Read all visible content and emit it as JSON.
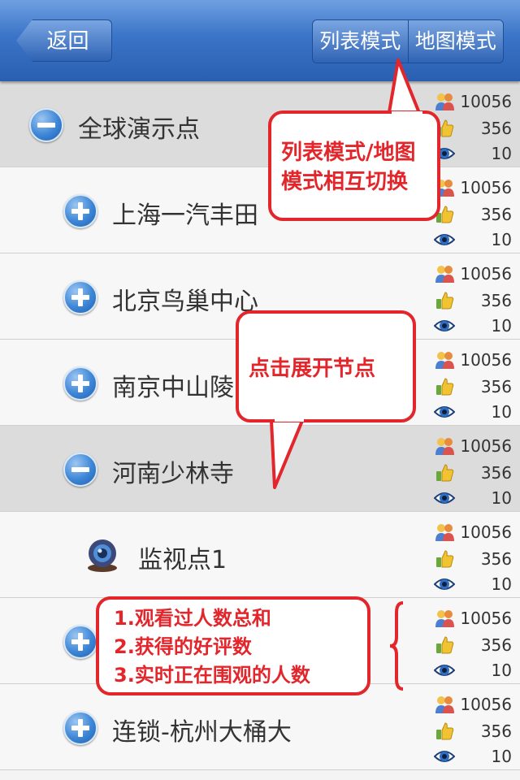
{
  "nav": {
    "back_label": "返回",
    "tabs": [
      "列表模式",
      "地图模式"
    ]
  },
  "rows": [
    {
      "label": "全球演示点",
      "state": "expanded",
      "icon": "minus-circle-icon",
      "views": "10056",
      "likes": "356",
      "watching": "10"
    },
    {
      "label": "上海一汽丰田",
      "state": "collapsed",
      "icon": "plus-circle-icon",
      "views": "10056",
      "likes": "356",
      "watching": "10"
    },
    {
      "label": "北京鸟巢中心",
      "state": "collapsed",
      "icon": "plus-circle-icon",
      "views": "10056",
      "likes": "356",
      "watching": "10"
    },
    {
      "label": "南京中山陵",
      "state": "collapsed",
      "icon": "plus-circle-icon",
      "views": "10056",
      "likes": "356",
      "watching": "10"
    },
    {
      "label": "河南少林寺",
      "state": "expanded",
      "icon": "minus-circle-icon",
      "views": "10056",
      "likes": "356",
      "watching": "10"
    },
    {
      "label": "监视点1",
      "state": "leaf",
      "icon": "webcam-icon",
      "views": "10056",
      "likes": "356",
      "watching": "10"
    },
    {
      "label": "",
      "state": "collapsed",
      "icon": "plus-circle-icon",
      "views": "10056",
      "likes": "356",
      "watching": "10"
    },
    {
      "label": "连锁-杭州大桶大",
      "state": "collapsed",
      "icon": "plus-circle-icon",
      "views": "10056",
      "likes": "356",
      "watching": "10"
    }
  ],
  "callouts": {
    "mode_switch": [
      "列表模式/地图",
      "模式相互切换"
    ],
    "expand_node": "点击展开节点",
    "stats_legend": [
      "1.观看过人数总和",
      "2.获得的好评数",
      "3.实时正在围观的人数"
    ]
  },
  "colors": {
    "nav_blue": "#2a5fb0",
    "callout_red": "#e2262b",
    "expanded_row": "#dcdcdc"
  }
}
